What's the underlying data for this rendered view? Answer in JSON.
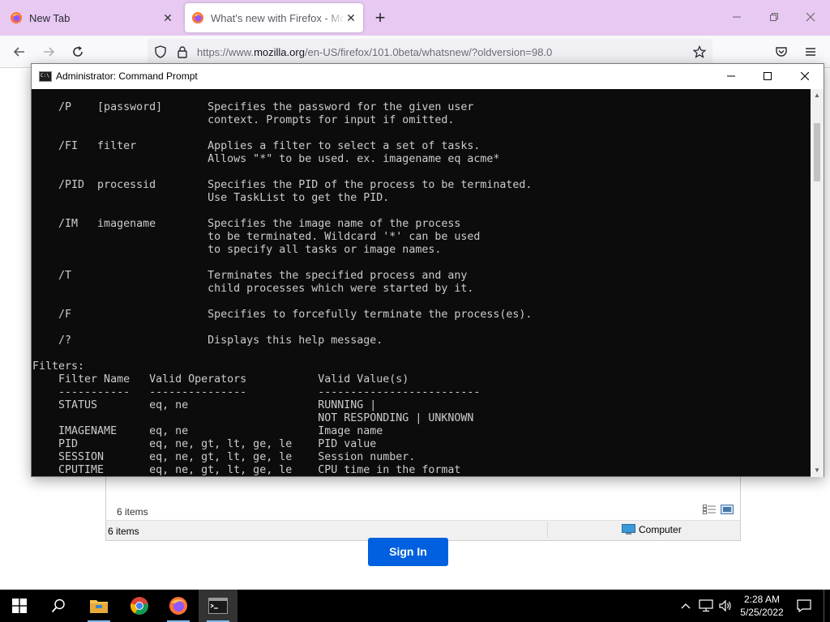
{
  "browser": {
    "tabs": [
      {
        "title": "New Tab",
        "active": false
      },
      {
        "title": "What's new with Firefox - More",
        "active": true
      }
    ],
    "url_prefix": "https://www.",
    "url_domain": "mozilla.org",
    "url_rest": "/en-US/firefox/101.0beta/whatsnew/?oldversion=98.0",
    "colors": {
      "tabbar": "#e7c9f2",
      "accent": "#0060df"
    }
  },
  "cmd": {
    "title": "Administrator: Command Prompt",
    "console_text": "    /P    [password]       Specifies the password for the given user\n                           context. Prompts for input if omitted.\n\n    /FI   filter           Applies a filter to select a set of tasks.\n                           Allows \"*\" to be used. ex. imagename eq acme*\n\n    /PID  processid        Specifies the PID of the process to be terminated.\n                           Use TaskList to get the PID.\n\n    /IM   imagename        Specifies the image name of the process\n                           to be terminated. Wildcard '*' can be used\n                           to specify all tasks or image names.\n\n    /T                     Terminates the specified process and any\n                           child processes which were started by it.\n\n    /F                     Specifies to forcefully terminate the process(es).\n\n    /?                     Displays this help message.\n\nFilters:\n    Filter Name   Valid Operators           Valid Value(s)\n    -----------   ---------------           -------------------------\n    STATUS        eq, ne                    RUNNING |\n                                            NOT RESPONDING | UNKNOWN\n    IMAGENAME     eq, ne                    Image name\n    PID           eq, ne, gt, lt, ge, le    PID value\n    SESSION       eq, ne, gt, lt, ge, le    Session number.\n    CPUTIME       eq, ne, gt, lt, ge, le    CPU time in the format"
  },
  "explorer": {
    "items_count": "6 items",
    "status_count": "6 items",
    "location": "Computer"
  },
  "page": {
    "signin_label": "Sign In"
  },
  "taskbar": {
    "time": "2:28 AM",
    "date": "5/25/2022",
    "apps": [
      "start",
      "search",
      "file-explorer",
      "chrome",
      "firefox",
      "command-prompt"
    ]
  }
}
